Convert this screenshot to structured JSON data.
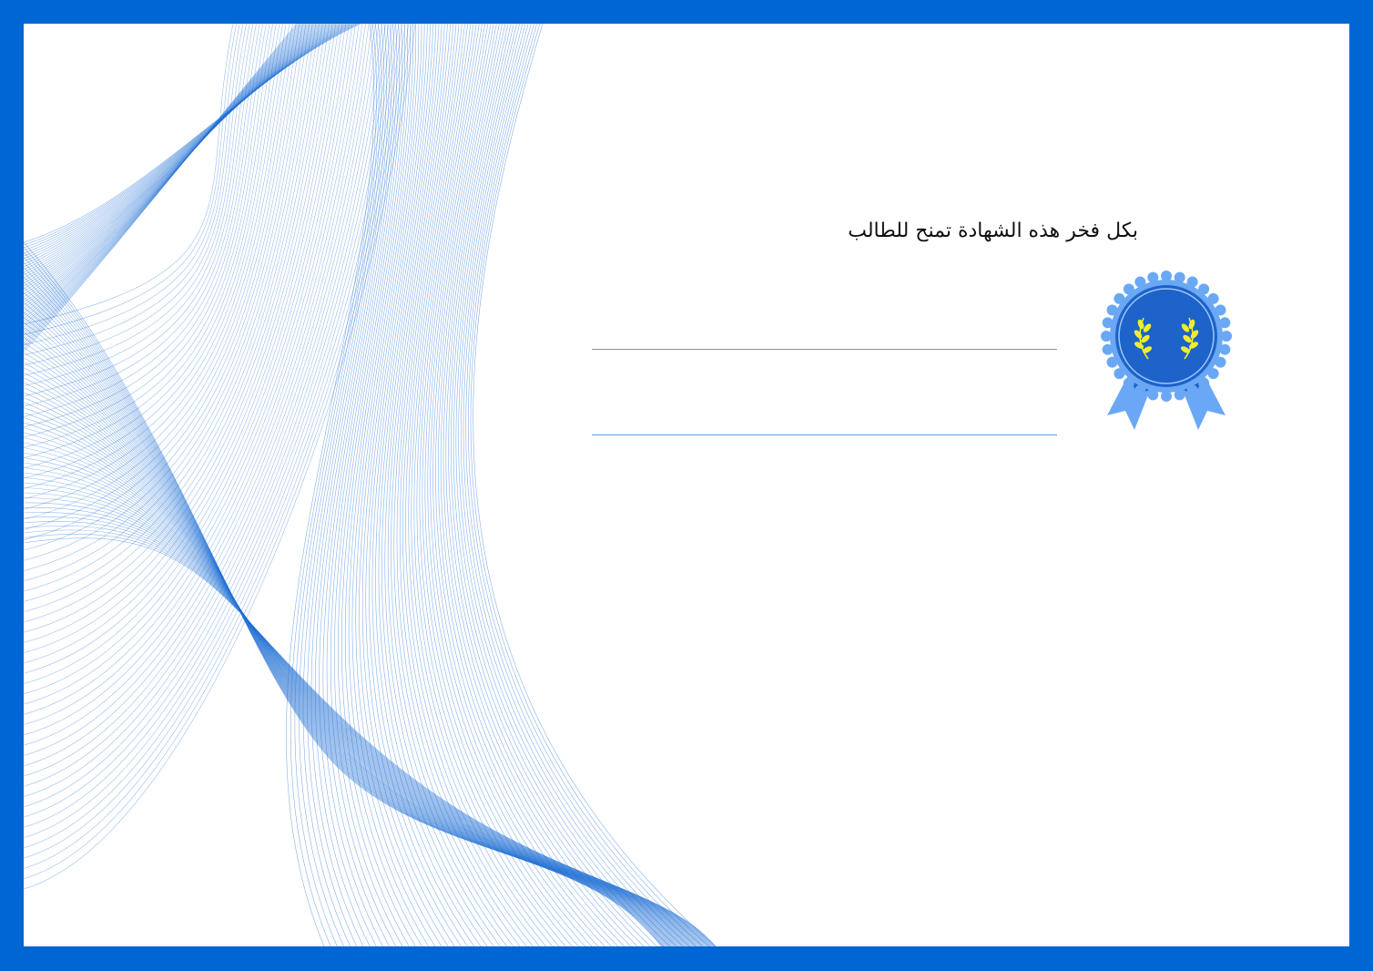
{
  "certificate": {
    "headline": "بكل فخر هذه الشهادة تمنح للطالب",
    "colors": {
      "border": "#0066d3",
      "paper": "#ffffff",
      "wave_lines": "#1f6fd6",
      "blank_lines": "#5a9fe8",
      "badge_outer": "#6aa8f5",
      "badge_inner": "#1d63c9",
      "laurel": "#f2ee2e"
    },
    "icons": {
      "badge": "award-rosette-icon",
      "laurel": "laurel-wreath-icon"
    }
  }
}
